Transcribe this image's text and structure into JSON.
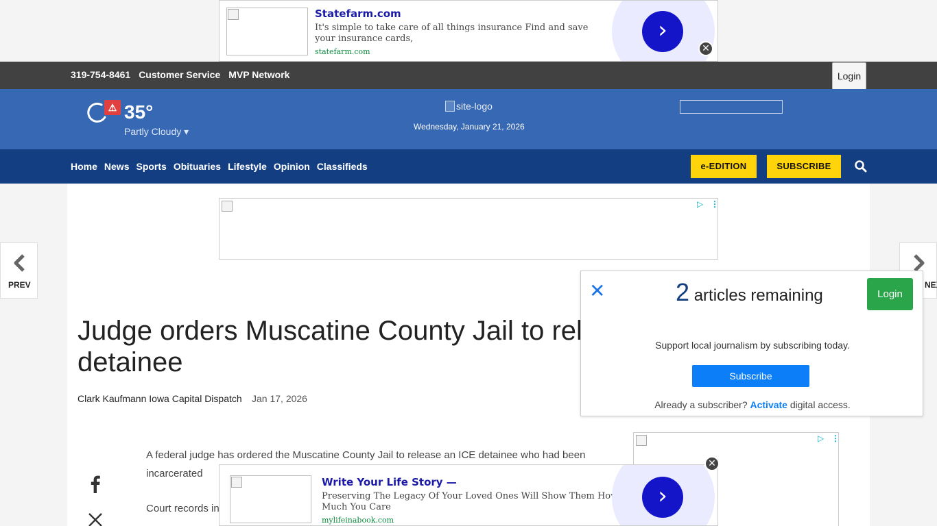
{
  "ads": {
    "top": {
      "title": "Statefarm.com",
      "description": "It's simple to take care of all things insurance Find and save your insurance cards,",
      "url": "statefarm.com",
      "arrow": "›",
      "close": "✕"
    },
    "bottom": {
      "title": "Write Your Life Story —",
      "description": "Preserving The Legacy Of Your Loved Ones Will Show Them How Much You Care",
      "url": "mylifeinabook.com",
      "arrow": "›",
      "close": "✕"
    },
    "adchoices_symbol": "▷",
    "dots_symbol": "⋮"
  },
  "utility": {
    "links": [
      "319-754-8461",
      "Customer Service",
      "MVP Network"
    ],
    "login_label": "Login"
  },
  "masthead": {
    "temperature": "35°",
    "condition": "Partly Cloudy ▾",
    "alert_symbol": "⚠",
    "logo_alt": "site-logo",
    "date": "Wednesday, January 21, 2026"
  },
  "nav": {
    "links": [
      "Home",
      "News",
      "Sports",
      "Obituaries",
      "Lifestyle",
      "Opinion",
      "Classifieds"
    ],
    "eedition_label": "e-EDITION",
    "subscribe_label": "SUBSCRIBE"
  },
  "pager": {
    "prev_label": "PREV",
    "next_label": "NEXT"
  },
  "article": {
    "headline": "Judge orders Muscatine County Jail to release ICE detainee",
    "byline": "Clark Kaufmann Iowa Capital Dispatch",
    "date": "Jan 17, 2026",
    "paragraphs": [
      "A federal judge has ordered the Muscatine County Jail to release an ICE detainee who had been incarcerated",
      "Court records indicate the man was taken into custody after fleeing his home"
    ]
  },
  "paywall": {
    "close": "✕",
    "count": "2",
    "count_text": " articles remaining",
    "login_label": "Login",
    "support_text": "Support local journalism by subscribing today.",
    "subscribe_label": "Subscribe",
    "already_text": "Already a subscriber? ",
    "activate_label": "Activate",
    "access_text": " digital access."
  },
  "colors": {
    "utility_bar": "#414141",
    "masthead": "#3768b4",
    "nav": "#133f82",
    "cta_yellow": "#ffd40a",
    "paywall_login": "#2aa54a",
    "paywall_subscribe": "#0b7ef8"
  }
}
